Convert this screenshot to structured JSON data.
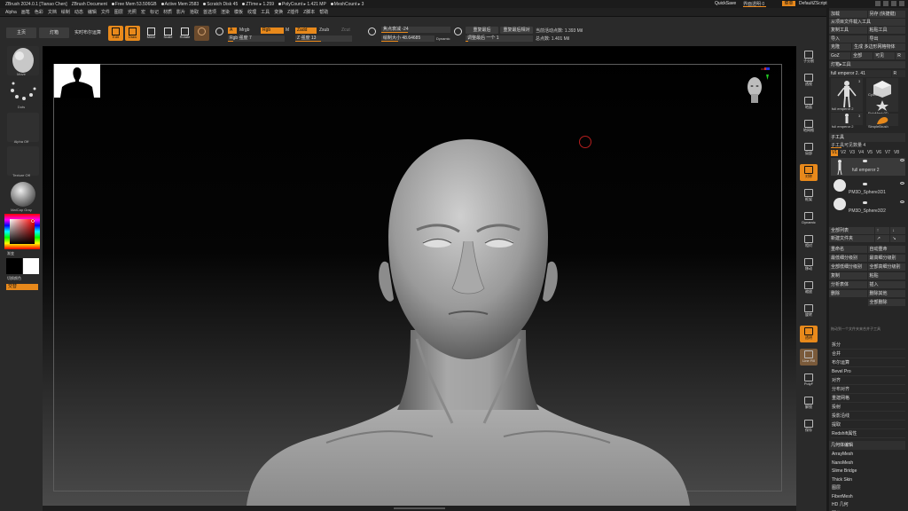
{
  "titlebar": {
    "app": "ZBrush 2024.0.1 [Tianao Chen]",
    "doc": "ZBrush Document",
    "free_mem": "Free Mem 53.506GB",
    "active_mem": "Active Mem 2583",
    "scratch": "Scratch Disk 45",
    "ztime": "ZTime ▸ 1.259",
    "polycount": "PolyCount ▸ 1.421 MP",
    "meshcount": "MeshCount ▸ 3",
    "quicksave": "QuickSave",
    "transparency": "界面透明 0",
    "menus": "菜单",
    "default_script": "DefaultZScript"
  },
  "menubar": [
    "Alpha",
    "画笔",
    "色彩",
    "文档",
    "绘制",
    "动态",
    "编辑",
    "文件",
    "图层",
    "光照",
    "宏",
    "标记",
    "材质",
    "影片",
    "拾取",
    "首选项",
    "渲染",
    "模板",
    "纹理",
    "工具",
    "变换",
    "Z插件",
    "Z脚本",
    "帮助"
  ],
  "toolbar": {
    "home": "主页",
    "lightbox": "灯箱",
    "live_boolean": "实时布尔运算",
    "edit": "Edit",
    "draw": "Draw",
    "move": "Move",
    "scale": "Scale",
    "rotate": "Rotate",
    "a_label": "A",
    "mrgb": "Mrgb",
    "rgb": "Rgb",
    "m": "M",
    "rgb_intensity": "Rgb 强度 7",
    "zadd": "Zadd",
    "zsub": "Zsub",
    "zcut": "Zcut",
    "z_intensity": "Z 强度 13",
    "focal_shift": "焦点衰减 -24",
    "draw_size": "绘制大小 48.64685",
    "dynamic": "Dynamic",
    "replay_last": "重复最后",
    "replay_last_rel": "重复最后相对",
    "adaptive": "调整最后 一个 1",
    "active_points": "当前活动点数: 1.393 Mil",
    "total_points": "总点数: 1.401 Mil"
  },
  "left_shelf": {
    "brush": "Move",
    "stroke": "Dots",
    "alpha": "Alpha Off",
    "texture": "Texture Off",
    "material": "MatCap Gray",
    "gradient": "渐变",
    "switch_color": "切换颜色",
    "alternate": "交替"
  },
  "right_shelf": [
    "子分割",
    "透视",
    "地面",
    "地网格",
    "局部",
    "对称",
    "框架",
    "Dynamic",
    "相对",
    "移动",
    "缩放",
    "旋转",
    "透明",
    "Line Fill",
    "PolyF",
    "解锁",
    "保存"
  ],
  "right_panel": {
    "row1": [
      "加载",
      "另存 (快捷键)"
    ],
    "row2": [
      "从项目文件载入工具"
    ],
    "row3": [
      "复制工具",
      "粘贴工具"
    ],
    "row4": [
      "导入",
      "导出"
    ],
    "row5": [
      "克隆",
      "生成 多边形网格物体"
    ],
    "row6": [
      "GoZ",
      "全部",
      "可见",
      "R"
    ],
    "row7": [
      "灯箱▸工具"
    ],
    "current_tool": "full emperor 2. 41",
    "r_label": "R",
    "tools": [
      {
        "name": "full emperor 2",
        "count": "3"
      },
      {
        "name": "Cylinder3D",
        "count": ""
      },
      {
        "name": "PolyMesh3D",
        "count": ""
      },
      {
        "name": "full emperor 2",
        "count": "3"
      },
      {
        "name": "SimpleBrush",
        "count": ""
      }
    ],
    "subtool_header": "子工具",
    "visible_count": "子工具可见数量 4",
    "tabs": [
      "V1",
      "V2",
      "V3",
      "V4",
      "V5",
      "V6",
      "V7",
      "V8"
    ],
    "subtools": [
      "full emperor 2",
      "PM3D_Sphere3D1",
      "PM3D_Sphere3D2"
    ],
    "list_all": "全部列表",
    "new_folder": "新建文件夹",
    "ops": [
      [
        "重命名",
        "自动重命"
      ],
      [
        "最低细分级别",
        "最高细分级别"
      ],
      [
        "全部低细分级别",
        "全部高细分级别"
      ],
      [
        "复制",
        "粘贴"
      ],
      [
        "分析表体",
        "插入"
      ],
      [
        "删除",
        "删除其他"
      ],
      [
        "",
        "全部删除"
      ]
    ],
    "footer_note": "拖动到一个文件夹来合并子工具",
    "sections": [
      "拆分",
      "合并",
      "布尔运算",
      "Bevel Pro",
      "对齐",
      "分布对齐",
      "重建网格",
      "投射",
      "投影沿线",
      "提取",
      "Redshift属性"
    ],
    "geometry_header": "几何体编辑",
    "geometry": [
      "ArrayMesh",
      "NanoMesh",
      "Slime Bridge",
      "Thick Skin",
      "图层",
      "FiberMesh",
      "HD 几何",
      "预览"
    ]
  },
  "colors": {
    "accent": "#e8891b",
    "bg": "#262626",
    "viewport_top": "#000000"
  }
}
